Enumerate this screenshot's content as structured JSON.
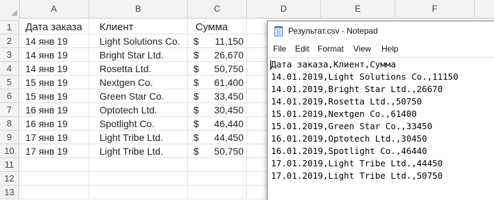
{
  "sheet": {
    "columns": [
      "A",
      "B",
      "C",
      "D",
      "E",
      "F"
    ],
    "rows": [
      "1",
      "2",
      "3",
      "4",
      "5",
      "6",
      "7",
      "8",
      "9",
      "10",
      "11",
      "12",
      "13"
    ],
    "header": {
      "date": "Дата заказа",
      "client": "Клиент",
      "sum": "Сумма"
    },
    "currency_symbol": "$",
    "data": [
      {
        "date": "14 янв 19",
        "client": "Light Solutions Co.",
        "sum": "11,150"
      },
      {
        "date": "14 янв 19",
        "client": "Bright Star Ltd.",
        "sum": "26,670"
      },
      {
        "date": "14 янв 19",
        "client": "Rosetta Ltd.",
        "sum": "50,750"
      },
      {
        "date": "15 янв 19",
        "client": "Nextgen Co.",
        "sum": "61,400"
      },
      {
        "date": "15 янв 19",
        "client": "Green Star Co.",
        "sum": "33,450"
      },
      {
        "date": "16 янв 19",
        "client": "Optotech Ltd.",
        "sum": "30,450"
      },
      {
        "date": "16 янв 19",
        "client": "Spotlight Co.",
        "sum": "46,440"
      },
      {
        "date": "17 янв 19",
        "client": "Light Tribe Ltd.",
        "sum": "44,450"
      },
      {
        "date": "17 янв 19",
        "client": "Light Tribe Ltd.",
        "sum": "50,750"
      }
    ]
  },
  "notepad": {
    "icon": "notepad-icon",
    "title": "Результат.csv - Notepad",
    "menu": [
      "File",
      "Edit",
      "Format",
      "View",
      "Help"
    ],
    "lines": [
      "Дата заказа,Клиент,Сумма",
      "14.01.2019,Light Solutions Co.,11150",
      "14.01.2019,Bright Star Ltd.,26670",
      "14.01.2019,Rosetta Ltd.,50750",
      "15.01.2019,Nextgen Co.,61400",
      "15.01.2019,Green Star Co.,33450",
      "16.01.2019,Optotech Ltd.,30450",
      "16.01.2019,Spotlight Co.,46440",
      "17.01.2019,Light Tribe Ltd.,44450",
      "17.01.2019,Light Tribe Ltd.,50750"
    ]
  }
}
